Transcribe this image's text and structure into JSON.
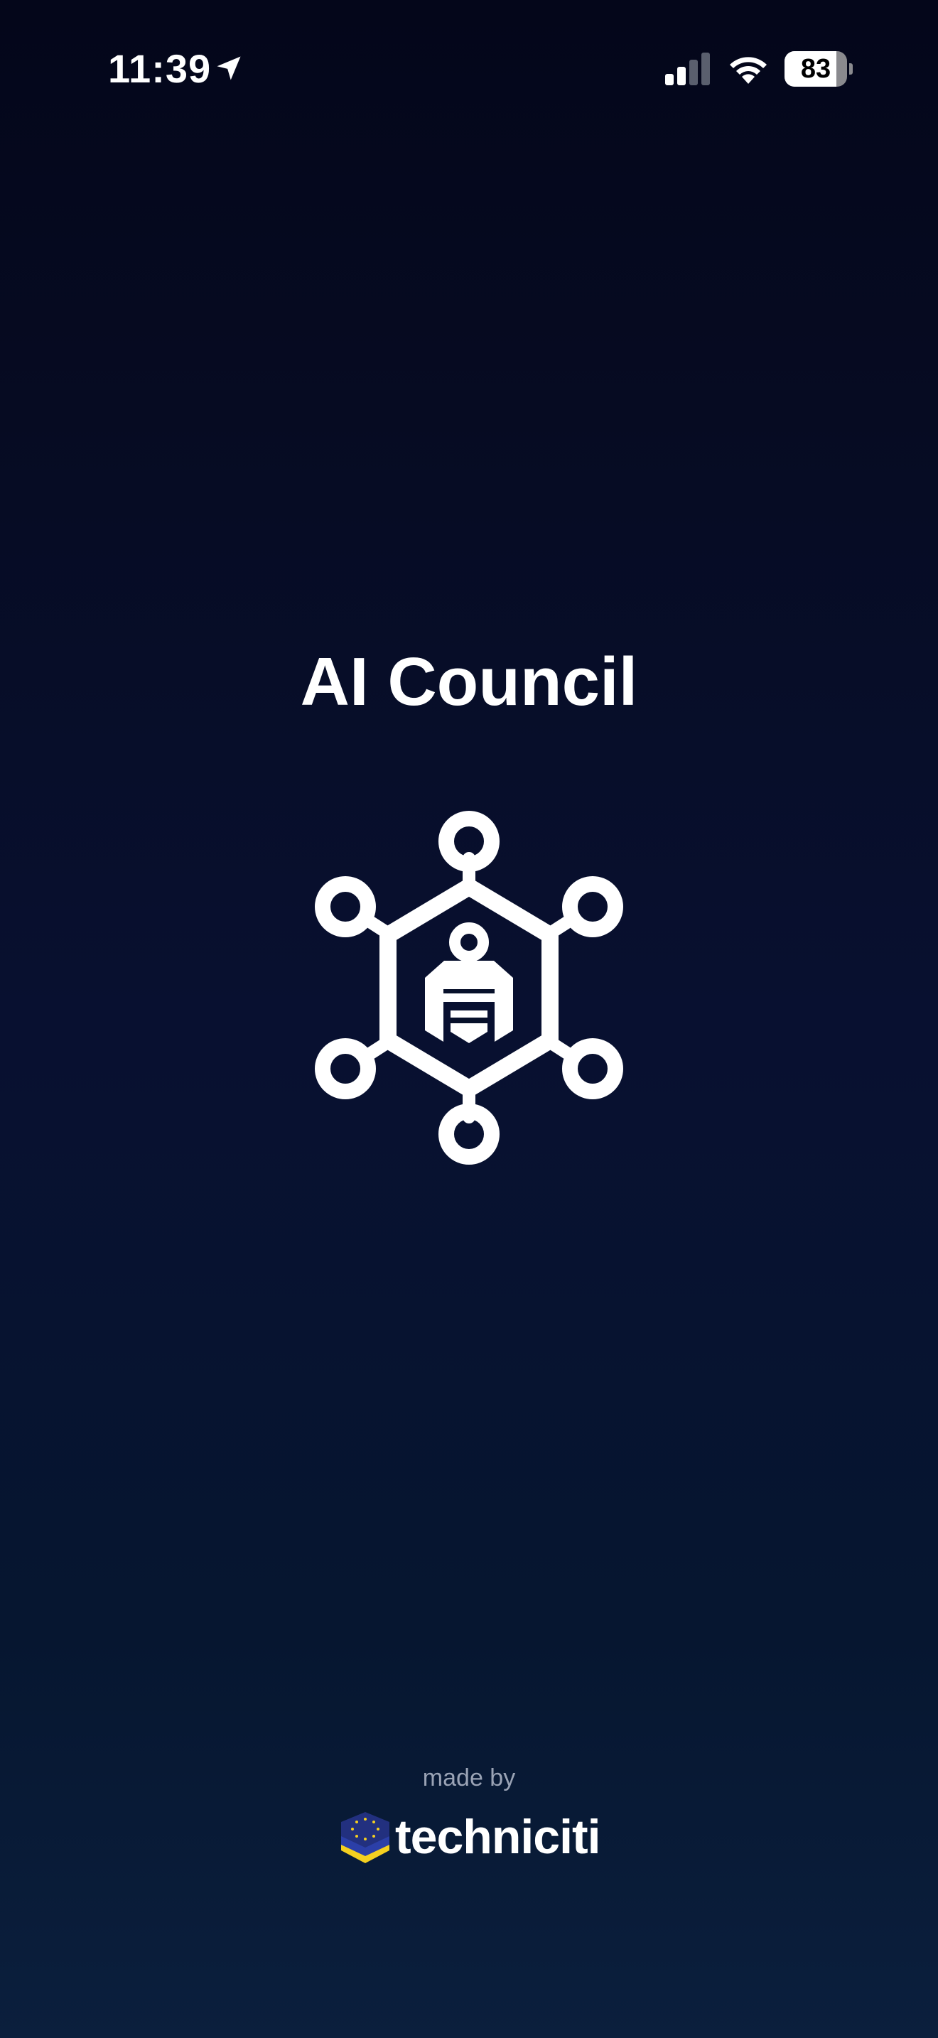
{
  "status_bar": {
    "time": "11:39",
    "battery_level": "83",
    "battery_fraction": 0.83,
    "icons": [
      "location-arrow-icon",
      "cellular-signal-icon",
      "wifi-icon",
      "battery-icon"
    ]
  },
  "splash": {
    "title": "AI Council",
    "logo_icon": "ai-council-network-icon"
  },
  "footer": {
    "made_by": "made by",
    "brand_name": "techniciti",
    "brand_icon": "techniciti-logo-icon"
  },
  "colors": {
    "background_top": "#04061a",
    "background_bottom": "#0b1f3d",
    "text": "#ffffff",
    "muted_text": "#9aa3b5",
    "brand_blue": "#2b3fa8",
    "brand_yellow": "#f5d020"
  }
}
